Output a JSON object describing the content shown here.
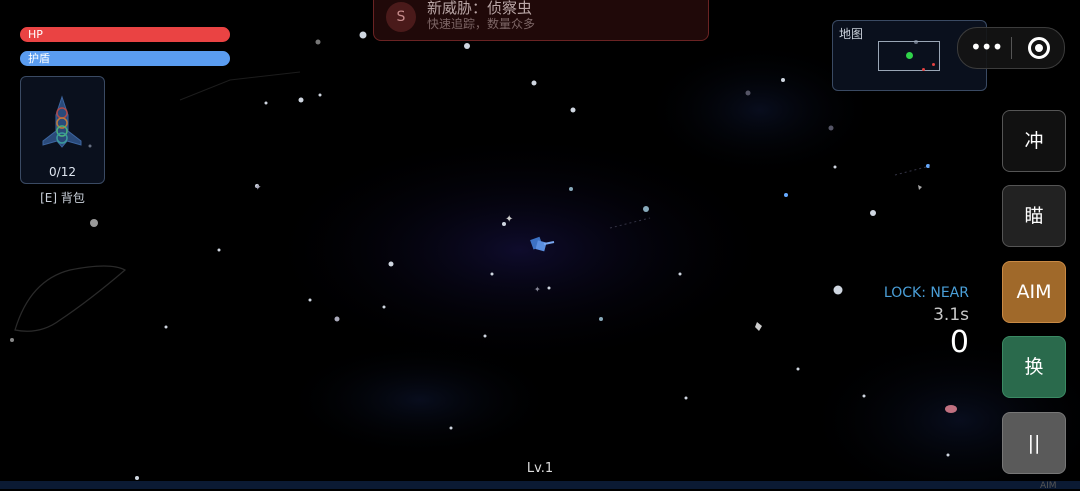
{
  "hud": {
    "hp": {
      "label": "HP",
      "value": 1.0,
      "color": "#ea4343"
    },
    "shield": {
      "label": "护盾",
      "value": 1.0,
      "color": "#5a9cf0"
    }
  },
  "backpack": {
    "count": "0/12",
    "label": "[E] 背包",
    "ship_icon": "spaceship-icon"
  },
  "threat": {
    "badge": "S",
    "title": "新威胁：侦察虫",
    "subtitle": "快速追踪，数量众多"
  },
  "minimap": {
    "title": "地图"
  },
  "capsule": {
    "menu_icon": "more-dots-icon",
    "close_icon": "target-circle-icon"
  },
  "side_buttons": {
    "dash": "冲",
    "aim_cn": "瞄",
    "aim": "AIM",
    "switch": "换",
    "pause": "||"
  },
  "lock": {
    "status": "LOCK: NEAR",
    "timer": "3.1s"
  },
  "score": "0",
  "level": "Lv.1",
  "corner_label": "AIM",
  "colors": {
    "background": "#000000",
    "aim_button": "#a0692a",
    "switch_button": "#2a6a4c",
    "lock_text": "#4a9fd8",
    "player_marker": "#2fd34a",
    "enemy_marker": "#e04040"
  }
}
